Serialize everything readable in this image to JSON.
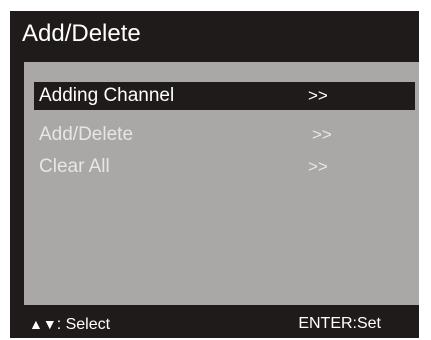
{
  "screen": {
    "title": "Add/Delete"
  },
  "menu": {
    "items": [
      {
        "label": "Adding Channel",
        "arrow": ">>",
        "selected": true
      },
      {
        "label": "Add/Delete",
        "arrow": ">>",
        "selected": false
      },
      {
        "label": "Clear All",
        "arrow": ">>",
        "selected": false
      }
    ]
  },
  "footer": {
    "select_keys": "▲▼",
    "select_label": ": Select",
    "enter_hint": "ENTER:Set"
  },
  "colors": {
    "frame": "#1e1b1a",
    "content_bg": "#a9a8a6",
    "text": "#ffffff"
  }
}
